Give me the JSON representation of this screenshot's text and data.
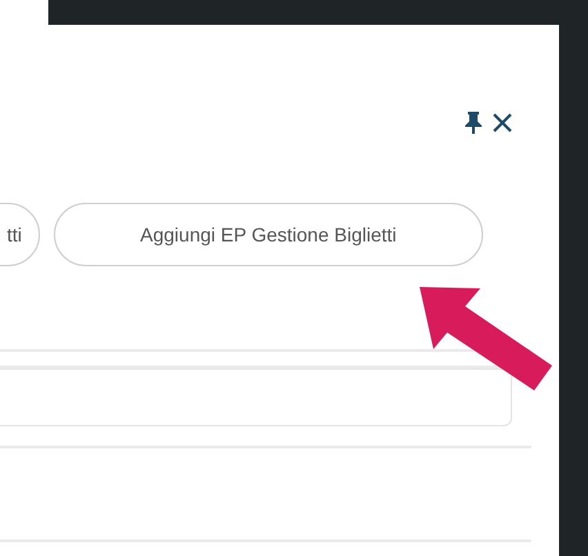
{
  "actions": [
    {
      "label": "tti"
    },
    {
      "label": "Aggiungi EP Gestione Biglietti"
    }
  ]
}
